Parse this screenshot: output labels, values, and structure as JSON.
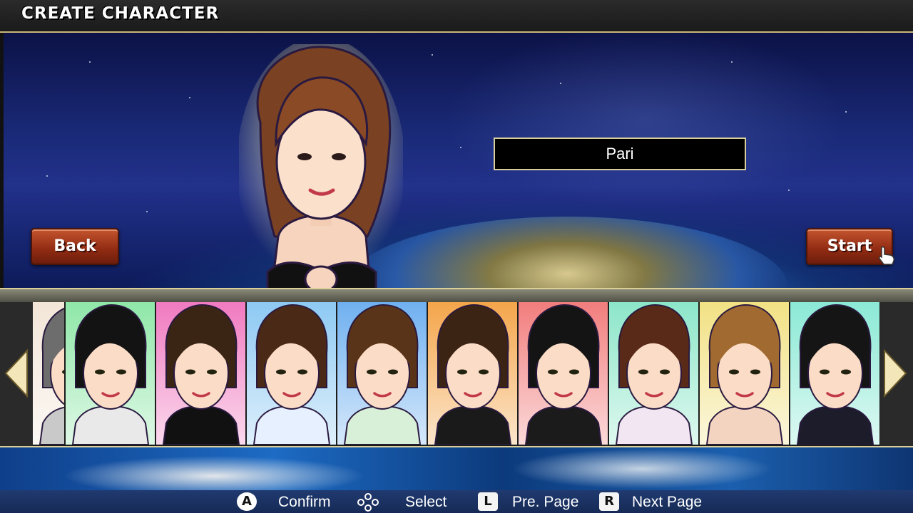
{
  "header": {
    "title": "CREATE  CHARACTER"
  },
  "name_field": {
    "value": "Pari"
  },
  "buttons": {
    "back": "Back",
    "start": "Start"
  },
  "portraits": [
    {
      "bg": "#f3e6d8",
      "hair": "#6d6d6d",
      "shirt": "#c9c9c9"
    },
    {
      "bg": "#8fe7a8",
      "hair": "#131313",
      "shirt": "#e9e9e9"
    },
    {
      "bg": "#f07ac0",
      "hair": "#3a2414",
      "shirt": "#111111"
    },
    {
      "bg": "#8dc9f3",
      "hair": "#4a2a16",
      "shirt": "#e6f0ff"
    },
    {
      "bg": "#6fb0f0",
      "hair": "#5a3418",
      "shirt": "#d8f0d8"
    },
    {
      "bg": "#f4a54a",
      "hair": "#3c2414",
      "shirt": "#1a1a1a"
    },
    {
      "bg": "#f27d7d",
      "hair": "#141414",
      "shirt": "#1b1b1b"
    },
    {
      "bg": "#8ce6c9",
      "hair": "#5a2a18",
      "shirt": "#f2e6f2"
    },
    {
      "bg": "#f2e184",
      "hair": "#a06a30",
      "shirt": "#f3d4c0"
    },
    {
      "bg": "#8be9d5",
      "hair": "#151515",
      "shirt": "#1c1c2a"
    }
  ],
  "controls": {
    "confirm_key": "A",
    "confirm": "Confirm",
    "select": "Select",
    "prev_key": "L",
    "prev": "Pre. Page",
    "next_key": "R",
    "next": "Next Page"
  },
  "colors": {
    "accent": "#d8cf9a",
    "button": "#a8381a",
    "bar": "#1a2f60"
  }
}
